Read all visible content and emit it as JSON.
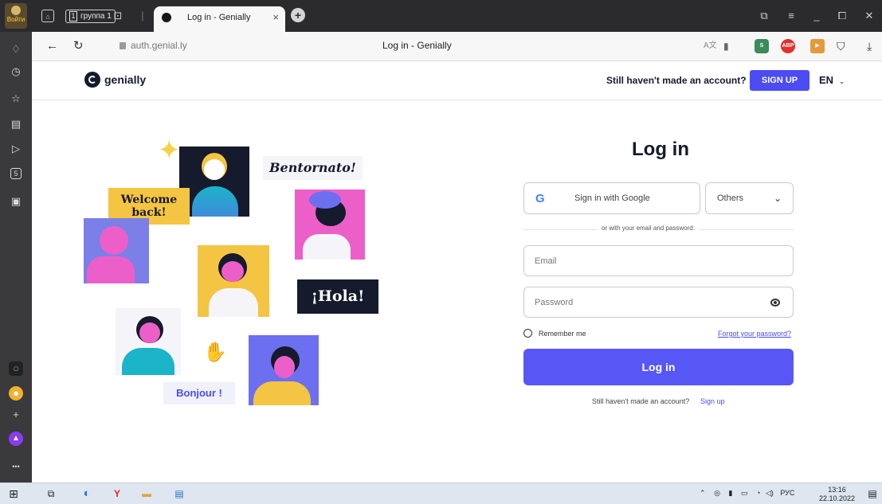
{
  "browser": {
    "login_button_label": "Войти",
    "tab_group_count": "1",
    "tab_group_label": "группа 1",
    "active_tab_title": "Log in - Genially",
    "tab_close": "×",
    "new_tab": "+",
    "address_url": "auth.genial.ly",
    "page_title": "Log in - Genially",
    "abp_label": "ABP"
  },
  "header": {
    "logo_text": "genially",
    "question": "Still haven't made an account?",
    "signup_label": "SIGN UP",
    "language": "EN"
  },
  "illustration": {
    "welcome": "Welcome back!",
    "bentornato": "Bentornato!",
    "hola": "¡Hola!",
    "bonjour": "Bonjour !"
  },
  "login": {
    "title": "Log in",
    "google_label": "Sign in with Google",
    "others_label": "Others",
    "divider_text": "or with your email and password:",
    "email_placeholder": "Email",
    "email_value": "",
    "password_placeholder": "Password",
    "password_value": "",
    "remember_label": "Remember me",
    "forgot_label": "Forgot your password?",
    "submit_label": "Log in",
    "bottom_question": "Still haven't made an account?",
    "bottom_link": "Sign up"
  },
  "taskbar": {
    "language": "РУС",
    "time": "13:16",
    "date": "22.10.2022"
  },
  "colors": {
    "accent": "#4b4cf3",
    "submit": "#5757f5",
    "navy": "#151a2d",
    "yellow": "#f4c542",
    "pink": "#f06bc8"
  }
}
